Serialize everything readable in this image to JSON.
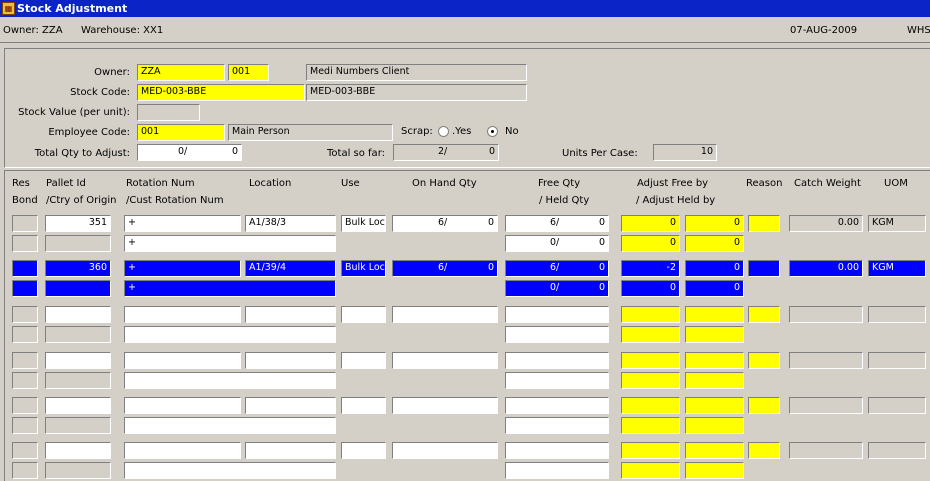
{
  "window": {
    "title": "Stock Adjustment",
    "icon": "form-icon"
  },
  "infobar": {
    "owner": "Owner:  ZZA",
    "warehouse": "Warehouse:  XX1",
    "date": "07-AUG-2009",
    "user": "WHS"
  },
  "header": {
    "owner_label": "Owner:",
    "owner_code": "ZZA",
    "owner_sub": "001",
    "owner_name": "Medi Numbers Client",
    "stock_code_label": "Stock Code:",
    "stock_code": "MED-003-BBE",
    "stock_desc": "MED-003-BBE",
    "stock_value_label": "Stock Value (per unit):",
    "stock_value": "",
    "employee_label": "Employee Code:",
    "employee_code": "001",
    "employee_name": "Main Person",
    "scrap_label": "Scrap:",
    "scrap_yes": ".Yes",
    "scrap_no": "No",
    "scrap_selected": "No",
    "total_adjust_label": "Total Qty to Adjust:",
    "total_adjust_a": "0/",
    "total_adjust_b": "0",
    "total_so_far_label": "Total so far:",
    "total_so_far_a": "2/",
    "total_so_far_b": "0",
    "units_per_case_label": "Units Per Case:",
    "units_per_case": "10"
  },
  "columns": {
    "res": "Res",
    "bond": "Bond",
    "pallet": "Pallet Id",
    "ctry": "/Ctry of Origin",
    "rotation": "Rotation Num",
    "cust_rotation": "/Cust Rotation Num",
    "location": "Location",
    "use": "Use",
    "on_hand": "On Hand Qty",
    "free_qty": "Free Qty",
    "held_qty": "/ Held Qty",
    "adjust_free": "Adjust Free by",
    "adjust_held": "/ Adjust Held by",
    "reason": "Reason",
    "catch_weight": "Catch Weight",
    "uom": "UOM"
  },
  "rows": [
    {
      "pallet": "351",
      "rotation": "+",
      "location": "A1/38/3",
      "use": "Bulk Loc",
      "onhand_a": "6/",
      "onhand_b": "0",
      "free_a": "6/",
      "free_b": "0",
      "adj_free_a": "0",
      "adj_free_b": "0",
      "catch": "0.00",
      "uom": "KGM",
      "cust_rotation": "+",
      "held_a": "0/",
      "held_b": "0",
      "adj_held_a": "0",
      "adj_held_b": "0"
    },
    {
      "pallet": "360",
      "rotation": "+",
      "location": "A1/39/4",
      "use": "Bulk Loc",
      "onhand_a": "6/",
      "onhand_b": "0",
      "free_a": "6/",
      "free_b": "0",
      "adj_free_a": "-2",
      "adj_free_b": "0",
      "catch": "0.00",
      "uom": "KGM",
      "cust_rotation": "+",
      "held_a": "0/",
      "held_b": "0",
      "adj_held_a": "0",
      "adj_held_b": "0"
    }
  ],
  "colors": {
    "selection": "#0000ff",
    "editable_highlight": "#ffff00",
    "title_bar": "#0a24c8",
    "background": "#d4d0c8"
  }
}
